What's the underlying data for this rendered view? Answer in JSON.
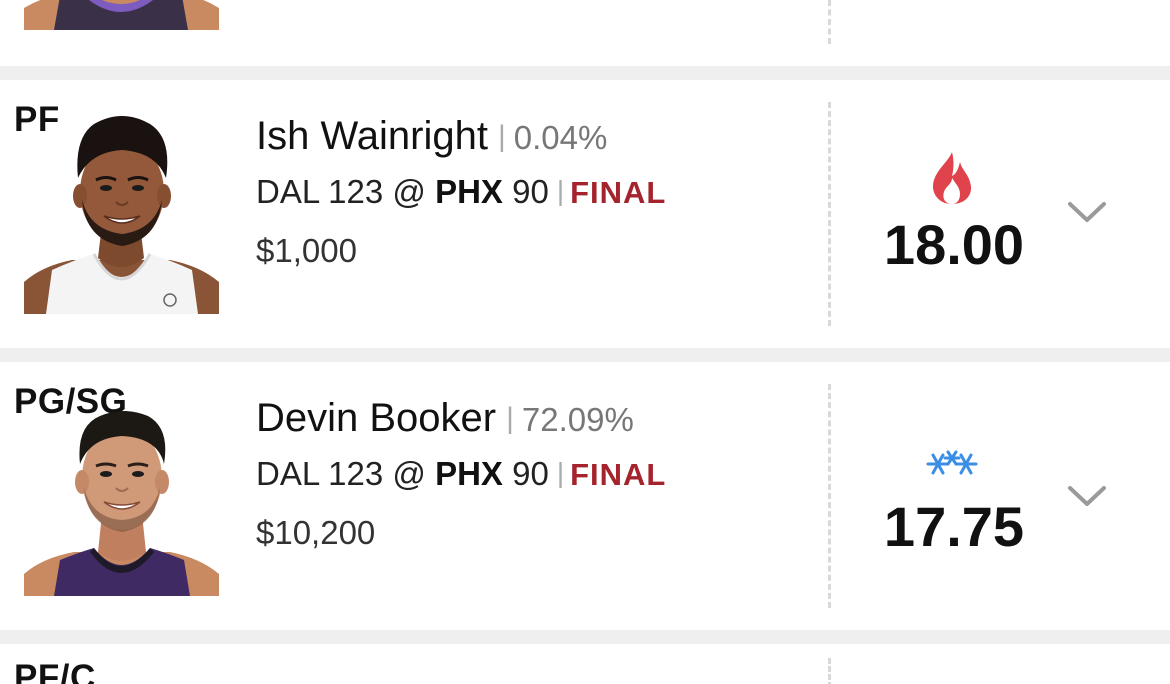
{
  "rows": [
    {
      "position": "PF",
      "player_name": "Ish Wainright",
      "ownership": "0.04%",
      "away_team": "DAL",
      "away_score": "123",
      "at": "@",
      "home_team": "PHX",
      "home_score": "90",
      "status": "FINAL",
      "salary": "$1,000",
      "trend_icon": "fire-icon",
      "fantasy_points": "18.00"
    },
    {
      "position": "PG/SG",
      "player_name": "Devin Booker",
      "ownership": "72.09%",
      "away_team": "DAL",
      "away_score": "123",
      "at": "@",
      "home_team": "PHX",
      "home_score": "90",
      "status": "FINAL",
      "salary": "$10,200",
      "trend_icon": "snowflake-icon",
      "fantasy_points": "17.75"
    }
  ],
  "next_row": {
    "position": "PF/C"
  },
  "colors": {
    "final": "#a4232c",
    "fire": "#e0434c",
    "snowflake": "#3b8ee6",
    "jersey_purple": "#3f2a64"
  }
}
